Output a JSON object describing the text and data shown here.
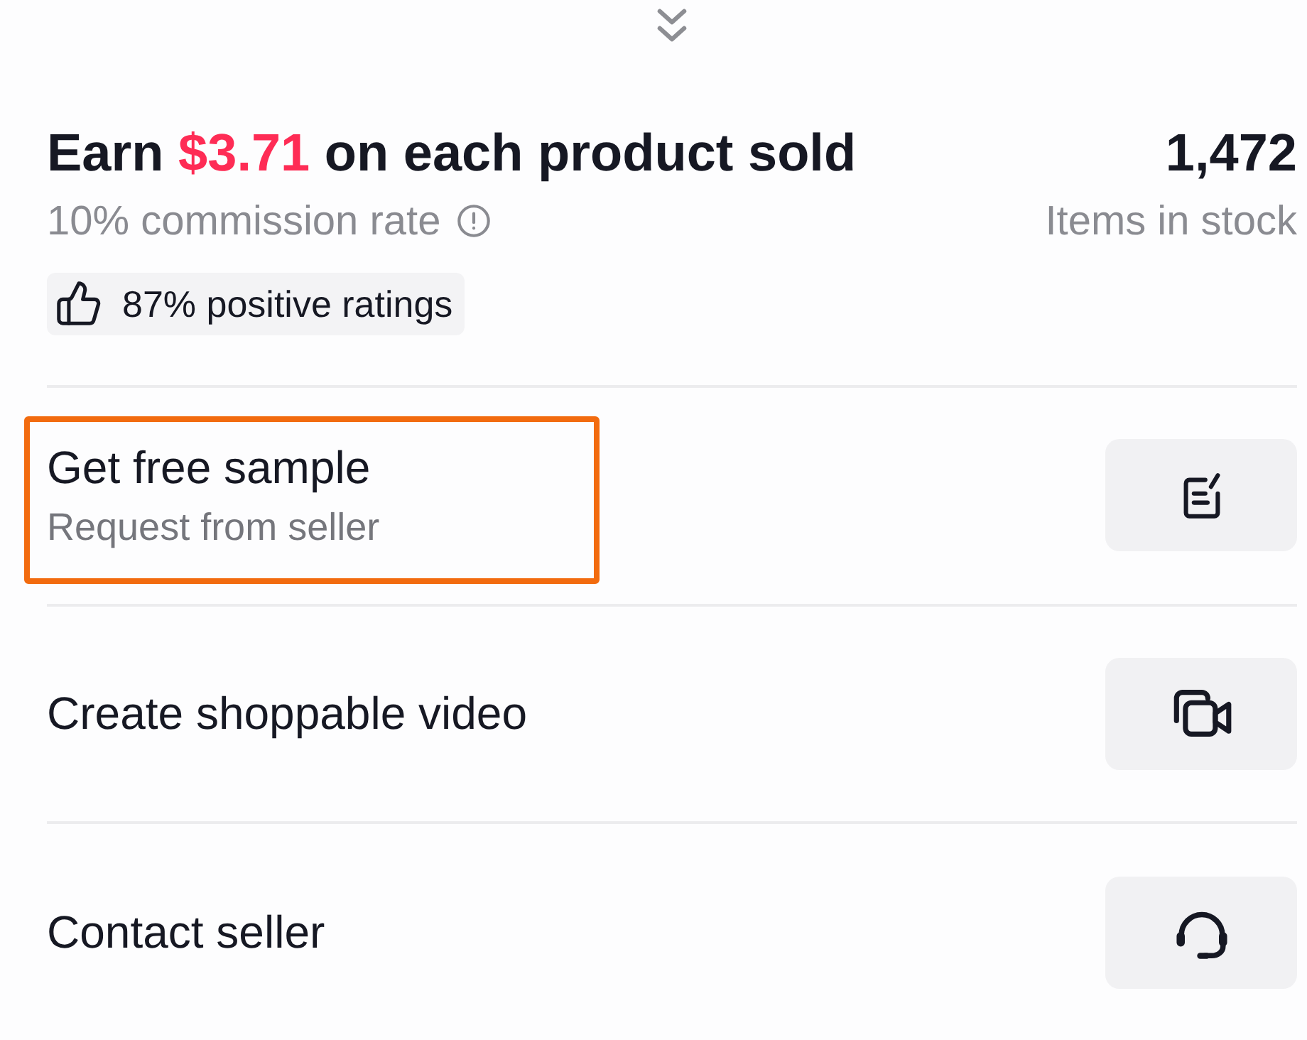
{
  "headline": {
    "before": "Earn",
    "amount": "$3.71",
    "after": "on each product sold"
  },
  "commission": "10% commission rate",
  "stock": {
    "count": "1,472",
    "label": "Items in stock"
  },
  "ratings_badge": "87% positive ratings",
  "actions": [
    {
      "kind": "sample",
      "title": "Get free sample",
      "subtitle": "Request from seller",
      "highlighted": true
    },
    {
      "kind": "video",
      "title": "Create shoppable video",
      "highlighted": false
    },
    {
      "kind": "contact",
      "title": "Contact seller",
      "highlighted": false
    }
  ]
}
